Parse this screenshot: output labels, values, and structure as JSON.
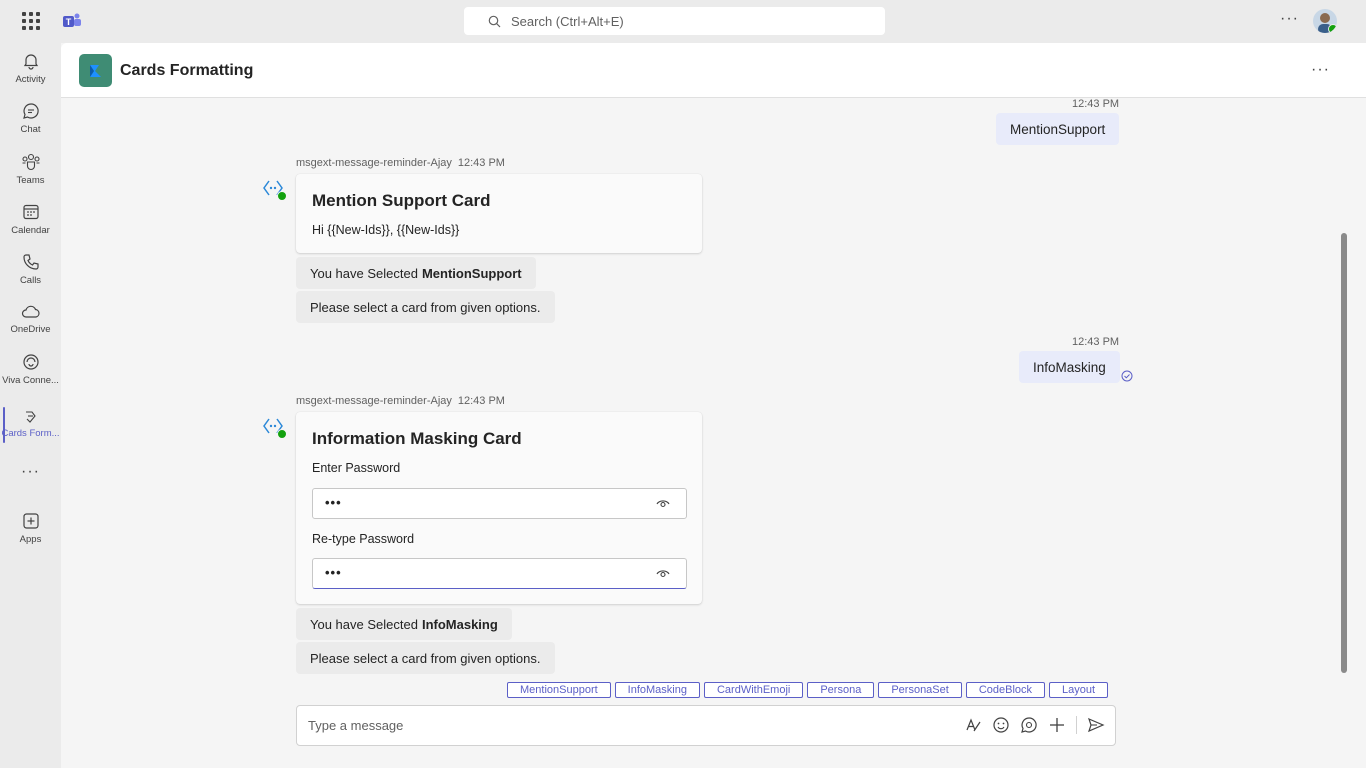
{
  "search": {
    "placeholder": "Search (Ctrl+Alt+E)"
  },
  "rail": {
    "items": [
      {
        "label": "Activity",
        "icon": "bell-icon"
      },
      {
        "label": "Chat",
        "icon": "chat-icon"
      },
      {
        "label": "Teams",
        "icon": "teams-icon"
      },
      {
        "label": "Calendar",
        "icon": "calendar-icon"
      },
      {
        "label": "Calls",
        "icon": "phone-icon"
      },
      {
        "label": "OneDrive",
        "icon": "cloud-icon"
      },
      {
        "label": "Viva Conne...",
        "icon": "viva-icon"
      },
      {
        "label": "Cards Form...",
        "icon": "app-icon",
        "active": true
      },
      {
        "label": "Apps",
        "icon": "add-app-icon"
      }
    ],
    "more": "···"
  },
  "header": {
    "title": "Cards Formatting",
    "more": "···"
  },
  "messages": {
    "m1": {
      "time": "12:43 PM",
      "text": "MentionSupport"
    },
    "bot1": {
      "sender": "msgext-message-reminder-Ajay",
      "time": "12:43 PM",
      "card_title": "Mention Support Card",
      "card_text": "Hi {{New-Ids}}, {{New-Ids}}",
      "selected_prefix": "You have Selected",
      "selected_value": "MentionSupport",
      "prompt": "Please select a card from given options."
    },
    "m2": {
      "time": "12:43 PM",
      "text": "InfoMasking"
    },
    "bot2": {
      "sender": "msgext-message-reminder-Ajay",
      "time": "12:43 PM",
      "card_title": "Information Masking Card",
      "label1": "Enter Password",
      "value1": "•••",
      "label2": "Re-type Password",
      "value2": "•••",
      "selected_prefix": "You have Selected",
      "selected_value": "InfoMasking",
      "prompt": "Please select a card from given options."
    }
  },
  "suggestions": [
    "MentionSupport",
    "InfoMasking",
    "CardWithEmoji",
    "Persona",
    "PersonaSet",
    "CodeBlock",
    "Layout"
  ],
  "compose": {
    "placeholder": "Type a message"
  },
  "colors": {
    "accent": "#5b5fc7",
    "presence": "#13a10e",
    "app_icon_bg": "#3f8c74"
  }
}
